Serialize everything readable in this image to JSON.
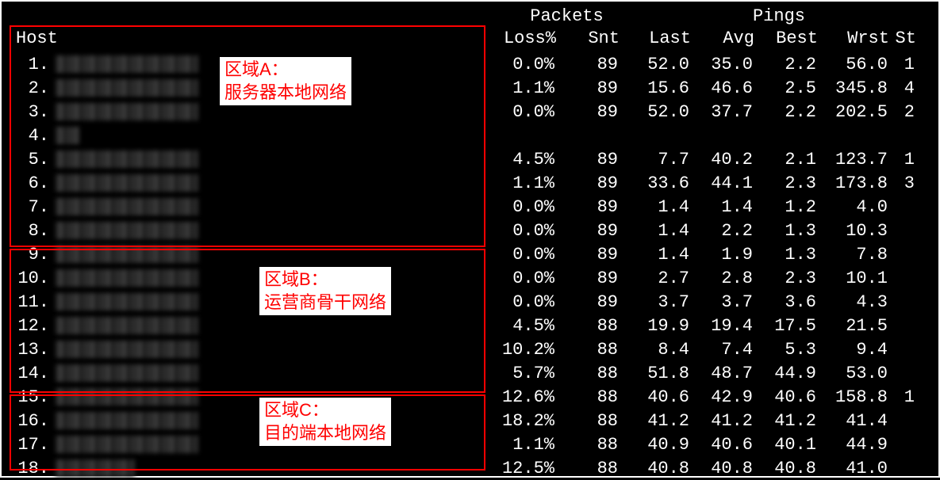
{
  "headers": {
    "host": "Host",
    "packets_group": "Packets",
    "pings_group": "Pings",
    "loss": "Loss%",
    "snt": "Snt",
    "last": "Last",
    "avg": "Avg",
    "best": "Best",
    "wrst": "Wrst",
    "st": "St"
  },
  "regions": {
    "a": {
      "title": "区域A：",
      "desc": "服务器本地网络"
    },
    "b": {
      "title": "区域B：",
      "desc": "运营商骨干网络"
    },
    "c": {
      "title": "区域C：",
      "desc": "目的端本地网络"
    }
  },
  "hops": [
    {
      "num": "1.",
      "loss": "0.0%",
      "snt": "89",
      "last": "52.0",
      "avg": "35.0",
      "best": "2.2",
      "wrst": "56.0",
      "st": "1"
    },
    {
      "num": "2.",
      "loss": "1.1%",
      "snt": "89",
      "last": "15.6",
      "avg": "46.6",
      "best": "2.5",
      "wrst": "345.8",
      "st": "4"
    },
    {
      "num": "3.",
      "loss": "0.0%",
      "snt": "89",
      "last": "52.0",
      "avg": "37.7",
      "best": "2.2",
      "wrst": "202.5",
      "st": "2"
    },
    {
      "num": "4.",
      "loss": "",
      "snt": "",
      "last": "",
      "avg": "",
      "best": "",
      "wrst": "",
      "st": ""
    },
    {
      "num": "5.",
      "loss": "4.5%",
      "snt": "89",
      "last": "7.7",
      "avg": "40.2",
      "best": "2.1",
      "wrst": "123.7",
      "st": "1"
    },
    {
      "num": "6.",
      "loss": "1.1%",
      "snt": "89",
      "last": "33.6",
      "avg": "44.1",
      "best": "2.3",
      "wrst": "173.8",
      "st": "3"
    },
    {
      "num": "7.",
      "loss": "0.0%",
      "snt": "89",
      "last": "1.4",
      "avg": "1.4",
      "best": "1.2",
      "wrst": "4.0",
      "st": ""
    },
    {
      "num": "8.",
      "loss": "0.0%",
      "snt": "89",
      "last": "1.4",
      "avg": "2.2",
      "best": "1.3",
      "wrst": "10.3",
      "st": ""
    },
    {
      "num": "9.",
      "loss": "0.0%",
      "snt": "89",
      "last": "1.4",
      "avg": "1.9",
      "best": "1.3",
      "wrst": "7.8",
      "st": ""
    },
    {
      "num": "10.",
      "loss": "0.0%",
      "snt": "89",
      "last": "2.7",
      "avg": "2.8",
      "best": "2.3",
      "wrst": "10.1",
      "st": ""
    },
    {
      "num": "11.",
      "loss": "0.0%",
      "snt": "89",
      "last": "3.7",
      "avg": "3.7",
      "best": "3.6",
      "wrst": "4.3",
      "st": ""
    },
    {
      "num": "12.",
      "loss": "4.5%",
      "snt": "88",
      "last": "19.9",
      "avg": "19.4",
      "best": "17.5",
      "wrst": "21.5",
      "st": ""
    },
    {
      "num": "13.",
      "loss": "10.2%",
      "snt": "88",
      "last": "8.4",
      "avg": "7.4",
      "best": "5.3",
      "wrst": "9.4",
      "st": ""
    },
    {
      "num": "14.",
      "loss": "5.7%",
      "snt": "88",
      "last": "51.8",
      "avg": "48.7",
      "best": "44.9",
      "wrst": "53.0",
      "st": ""
    },
    {
      "num": "15.",
      "loss": "12.6%",
      "snt": "88",
      "last": "40.6",
      "avg": "42.9",
      "best": "40.6",
      "wrst": "158.8",
      "st": "1"
    },
    {
      "num": "16.",
      "loss": "18.2%",
      "snt": "88",
      "last": "41.2",
      "avg": "41.2",
      "best": "41.2",
      "wrst": "41.4",
      "st": ""
    },
    {
      "num": "17.",
      "loss": "1.1%",
      "snt": "88",
      "last": "40.9",
      "avg": "40.6",
      "best": "40.1",
      "wrst": "44.9",
      "st": ""
    },
    {
      "num": "18.",
      "loss": "12.5%",
      "snt": "88",
      "last": "40.8",
      "avg": "40.8",
      "best": "40.8",
      "wrst": "41.0",
      "st": ""
    }
  ]
}
